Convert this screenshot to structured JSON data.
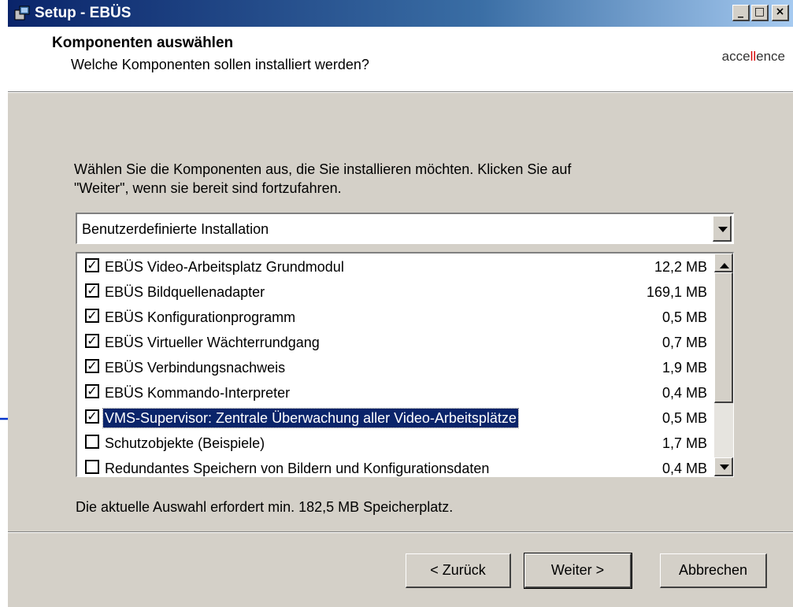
{
  "window": {
    "title": "Setup - EBÜS",
    "minimize": "_",
    "maximize": "□",
    "close": "×"
  },
  "header": {
    "title": "Komponenten auswählen",
    "subtitle": "Welche Komponenten sollen installiert werden?",
    "logo_prefix": "acce",
    "logo_highlight": "ll",
    "logo_suffix": "ence"
  },
  "instructions": {
    "line1": "Wählen Sie die Komponenten aus, die Sie installieren möchten. Klicken Sie auf",
    "line2": "\"Weiter\", wenn sie bereit sind fortzufahren."
  },
  "install_type": {
    "selected": "Benutzerdefinierte Installation"
  },
  "components": [
    {
      "label": "EBÜS Video-Arbeitsplatz Grundmodul",
      "size": "12,2 MB",
      "checked": true
    },
    {
      "label": "EBÜS Bildquellenadapter",
      "size": "169,1 MB",
      "checked": true
    },
    {
      "label": "EBÜS Konfigurationprogramm",
      "size": "0,5 MB",
      "checked": true
    },
    {
      "label": "EBÜS Virtueller Wächterrundgang",
      "size": "0,7 MB",
      "checked": true
    },
    {
      "label": "EBÜS Verbindungsnachweis",
      "size": "1,9 MB",
      "checked": true
    },
    {
      "label": "EBÜS Kommando-Interpreter",
      "size": "0,4 MB",
      "checked": true
    },
    {
      "label": "VMS-Supervisor: Zentrale Überwachung aller Video-Arbeitsplätze",
      "size": "0,5 MB",
      "checked": true,
      "selected": true
    },
    {
      "label": "Schutzobjekte (Beispiele)",
      "size": "1,7 MB",
      "checked": false
    },
    {
      "label": "Redundantes Speichern von Bildern und Konfigurationsdaten",
      "size": "0,4 MB",
      "checked": false
    }
  ],
  "space_required": "Die aktuelle Auswahl erfordert min. 182,5 MB Speicherplatz.",
  "buttons": {
    "back": "< Zurück",
    "next": "Weiter >",
    "cancel": "Abbrechen"
  },
  "check_mark": "✓",
  "colors": {
    "title_bar": "#0a246a",
    "selection": "#0a246a",
    "pointer_arrow": "#0033cc",
    "logo_accent": "#d60000"
  }
}
